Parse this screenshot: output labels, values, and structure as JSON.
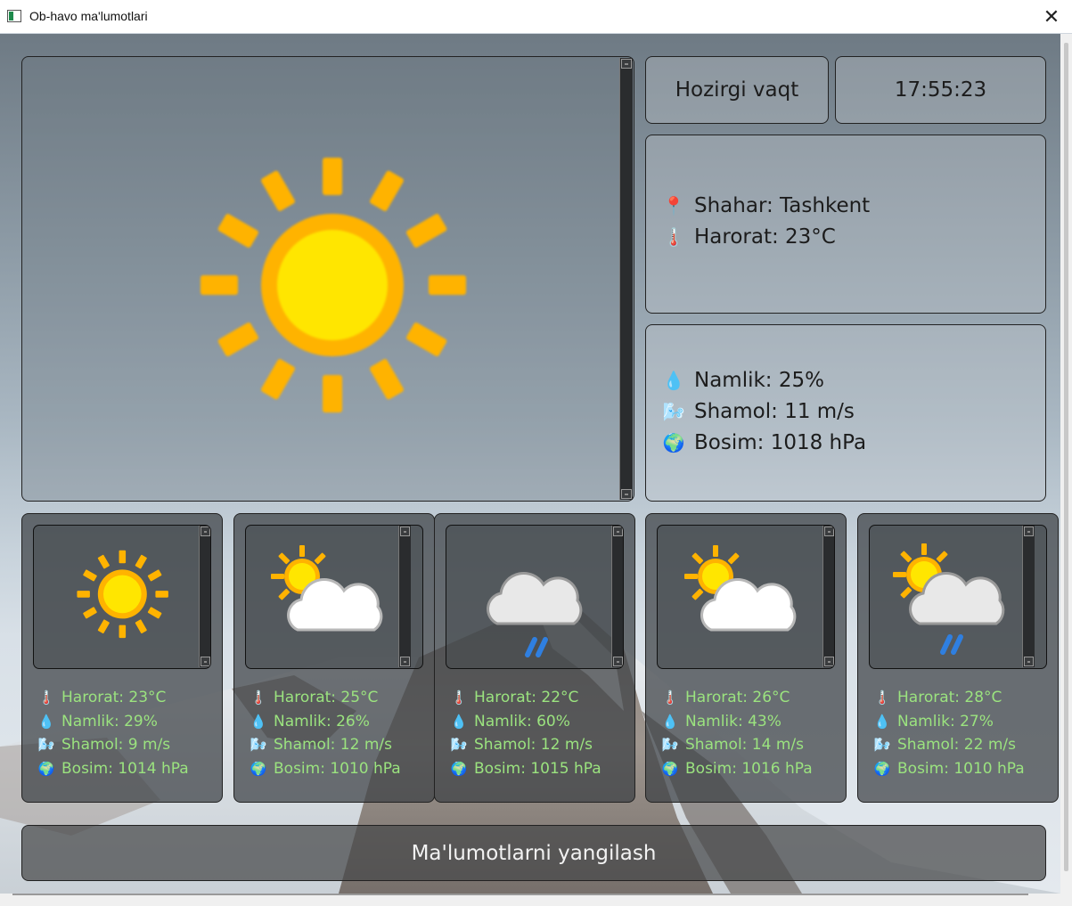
{
  "window": {
    "title": "Ob-havo ma'lumotlari",
    "close_glyph": "✕"
  },
  "header": {
    "time_label": "Hozirgi vaqt",
    "time_value": "17:55:23"
  },
  "current": {
    "icon": "sun-icon",
    "city": "Shahar: Tashkent",
    "temperature": "Harorat: 23°C",
    "humidity": "Namlik: 25%",
    "wind": "Shamol: 11 m/s",
    "pressure": "Bosim: 1018 hPa"
  },
  "forecast": [
    {
      "icon": "sun-icon",
      "temperature": "Harorat: 23°C",
      "humidity": "Namlik: 29%",
      "wind": "Shamol: 9 m/s",
      "pressure": "Bosim: 1014 hPa"
    },
    {
      "icon": "partly-cloudy-icon",
      "temperature": "Harorat: 25°C",
      "humidity": "Namlik: 26%",
      "wind": "Shamol: 12 m/s",
      "pressure": "Bosim: 1010 hPa"
    },
    {
      "icon": "rain-cloud-icon",
      "temperature": "Harorat: 22°C",
      "humidity": "Namlik: 60%",
      "wind": "Shamol: 12 m/s",
      "pressure": "Bosim: 1015 hPa"
    },
    {
      "icon": "partly-cloudy-icon",
      "temperature": "Harorat: 26°C",
      "humidity": "Namlik: 43%",
      "wind": "Shamol: 14 m/s",
      "pressure": "Bosim: 1016 hPa"
    },
    {
      "icon": "sun-cloud-rain-icon",
      "temperature": "Harorat: 28°C",
      "humidity": "Namlik: 27%",
      "wind": "Shamol: 22 m/s",
      "pressure": "Bosim: 1010 hPa"
    }
  ],
  "refresh_button": "Ma'lumotlarni yangilash",
  "colors": {
    "stats_text": "#9be37f",
    "sun_outer": "#ffb300",
    "sun_inner": "#ffe600"
  }
}
